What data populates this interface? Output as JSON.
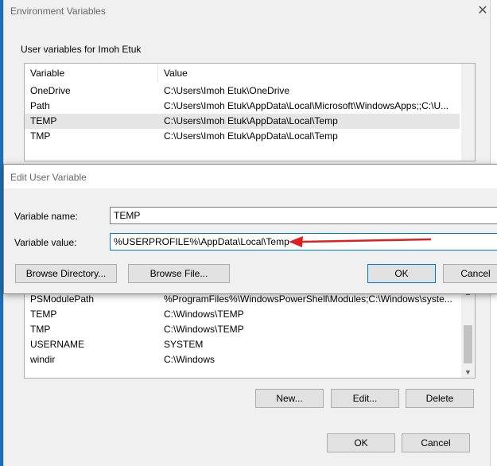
{
  "env_dialog": {
    "title": "Environment Variables",
    "user_group_label": "User variables for Imoh Etuk",
    "columns": [
      "Variable",
      "Value"
    ],
    "user_rows": [
      {
        "variable": "OneDrive",
        "value": "C:\\Users\\Imoh Etuk\\OneDrive"
      },
      {
        "variable": "Path",
        "value": "C:\\Users\\Imoh Etuk\\AppData\\Local\\Microsoft\\WindowsApps;;C:\\U..."
      },
      {
        "variable": "TEMP",
        "value": "C:\\Users\\Imoh Etuk\\AppData\\Local\\Temp"
      },
      {
        "variable": "TMP",
        "value": "C:\\Users\\Imoh Etuk\\AppData\\Local\\Temp"
      }
    ],
    "system_rows": [
      {
        "variable": "PSModulePath",
        "value": "%ProgramFiles%\\WindowsPowerShell\\Modules;C:\\Windows\\syste..."
      },
      {
        "variable": "TEMP",
        "value": "C:\\Windows\\TEMP"
      },
      {
        "variable": "TMP",
        "value": "C:\\Windows\\TEMP"
      },
      {
        "variable": "USERNAME",
        "value": "SYSTEM"
      },
      {
        "variable": "windir",
        "value": "C:\\Windows"
      }
    ],
    "system_buttons": {
      "new": "New...",
      "edit": "Edit...",
      "delete": "Delete"
    },
    "footer_buttons": {
      "ok": "OK",
      "cancel": "Cancel"
    },
    "close_icon": "close-icon"
  },
  "edit_dialog": {
    "title": "Edit User Variable",
    "name_label": "Variable name:",
    "name_value": "TEMP",
    "value_label": "Variable value:",
    "value_value": "%USERPROFILE%\\AppData\\Local\\Temp",
    "buttons": {
      "browse_dir": "Browse Directory...",
      "browse_file": "Browse File...",
      "ok": "OK",
      "cancel": "Cancel"
    },
    "annotation_arrow_color": "#e02020"
  }
}
